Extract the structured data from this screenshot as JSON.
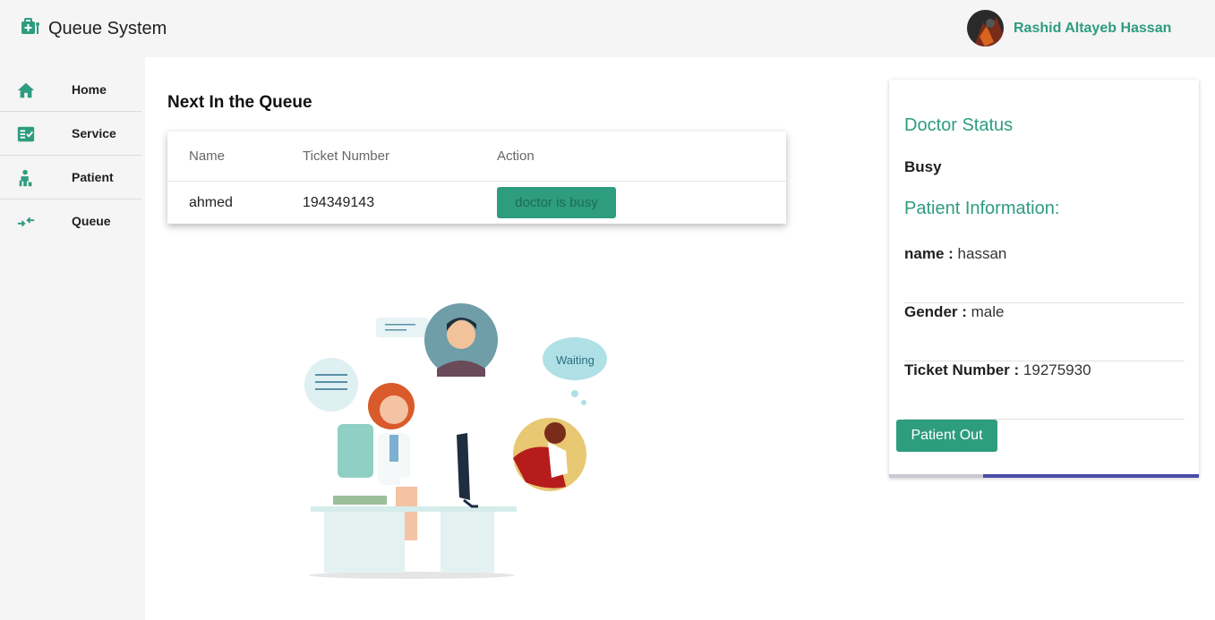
{
  "app": {
    "title": "Queue System",
    "accent_color": "#2e9c7f",
    "user_name": "Rashid Altayeb Hassan"
  },
  "sidebar": {
    "items": [
      {
        "label": "Home",
        "icon": "home-icon"
      },
      {
        "label": "Service",
        "icon": "service-icon"
      },
      {
        "label": "Patient",
        "icon": "patient-icon"
      },
      {
        "label": "Queue",
        "icon": "queue-icon"
      }
    ]
  },
  "queue": {
    "title": "Next In the Queue",
    "columns": [
      "Name",
      "Ticket Number",
      "Action"
    ],
    "rows": [
      {
        "name": "ahmed",
        "ticket": "194349143",
        "action": "doctor is busy"
      }
    ]
  },
  "illustration": {
    "bubble_text": "Waiting"
  },
  "doctor": {
    "status_title": "Doctor Status",
    "status_value": "Busy",
    "patient_title": "Patient Information:",
    "fields": [
      {
        "label": "name :",
        "value": "hassan"
      },
      {
        "label": "Gender :",
        "value": "male"
      },
      {
        "label": "Ticket Number :",
        "value": "19275930"
      }
    ],
    "patient_out_label": "Patient Out"
  }
}
